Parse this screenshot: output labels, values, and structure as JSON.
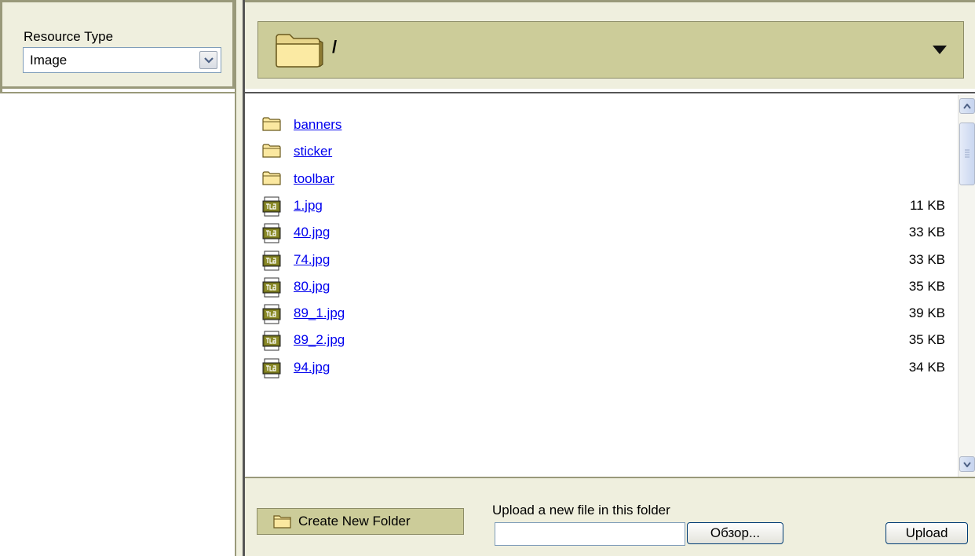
{
  "left": {
    "resource_type_label": "Resource Type",
    "resource_type_value": "Image"
  },
  "path": {
    "current": "/"
  },
  "files": [
    {
      "kind": "folder",
      "name": "banners",
      "size": ""
    },
    {
      "kind": "folder",
      "name": "sticker",
      "size": ""
    },
    {
      "kind": "folder",
      "name": "toolbar",
      "size": ""
    },
    {
      "kind": "jpg",
      "name": "1.jpg",
      "size": "11 KB"
    },
    {
      "kind": "jpg",
      "name": "40.jpg",
      "size": "33 KB"
    },
    {
      "kind": "jpg",
      "name": "74.jpg",
      "size": "33 KB"
    },
    {
      "kind": "jpg",
      "name": "80.jpg",
      "size": "35 KB"
    },
    {
      "kind": "jpg",
      "name": "89_1.jpg",
      "size": "39 KB"
    },
    {
      "kind": "jpg",
      "name": "89_2.jpg",
      "size": "35 KB"
    },
    {
      "kind": "jpg",
      "name": "94.jpg",
      "size": "34 KB"
    }
  ],
  "bottom": {
    "create_folder_label": "Create New Folder",
    "upload_label": "Upload a new file in this folder",
    "file_input_value": "",
    "browse_label": "Обзор...",
    "upload_button_label": "Upload"
  },
  "icons": {
    "folder": "folder-icon",
    "jpg": "jpg-file-icon",
    "dropdown": "chevron-down-icon"
  },
  "colors": {
    "panel_bg": "#efefde",
    "bar_bg": "#cccc99",
    "link": "#0000ee"
  }
}
